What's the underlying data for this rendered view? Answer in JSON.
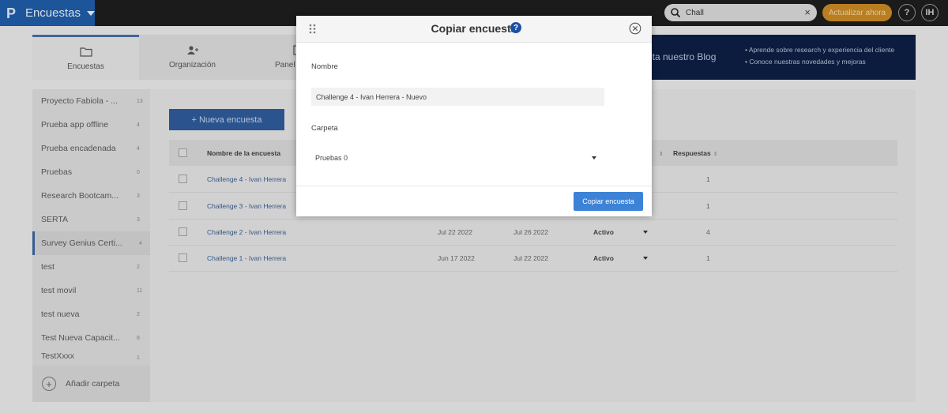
{
  "topbar": {
    "app_title": "Encuestas",
    "search_value": "Chall",
    "upgrade_label": "Actualizar ahora",
    "help_label": "?",
    "avatar_initials": "IH",
    "brand_color": "#1f5da6"
  },
  "tabs": [
    {
      "label": "Encuestas",
      "icon": "folder-icon"
    },
    {
      "label": "Organización",
      "icon": "users-icon"
    },
    {
      "label": "Panel",
      "icon": "panel-icon"
    }
  ],
  "blog_banner": {
    "title": "ita nuestro Blog",
    "bullets": [
      "Aprende sobre research y experiencia del cliente",
      "Conoce nuestras novedades y mejoras"
    ]
  },
  "sidebar": {
    "folders": [
      {
        "name": "Proyecto Fabiola - ...",
        "count": "13"
      },
      {
        "name": "Prueba app offline",
        "count": "4"
      },
      {
        "name": "Prueba encadenada",
        "count": "4"
      },
      {
        "name": "Pruebas",
        "count": "0"
      },
      {
        "name": "Research Bootcam...",
        "count": "3"
      },
      {
        "name": "SERTA",
        "count": "3"
      },
      {
        "name": "Survey Genius Certi...",
        "count": "4"
      },
      {
        "name": "test",
        "count": "2"
      },
      {
        "name": "test movil",
        "count": "11"
      },
      {
        "name": "test nueva",
        "count": "2"
      },
      {
        "name": "Test Nueva Capacit...",
        "count": "8"
      },
      {
        "name": "TestXxxx",
        "count": "1"
      }
    ],
    "active_index": 6,
    "add_folder_label": "Añadir carpeta"
  },
  "main": {
    "new_survey_label": "+ Nueva encuesta",
    "columns": {
      "name": "Nombre de la encuesta",
      "responses": "Respuestas"
    },
    "rows": [
      {
        "name": "Challenge 4 - Ivan Herrera",
        "created": "",
        "modified": "",
        "status": "",
        "responses": "1"
      },
      {
        "name": "Challenge 3 - Ivan Herrera",
        "created": "",
        "modified": "",
        "status": "",
        "responses": "1"
      },
      {
        "name": "Challenge 2 - Ivan Herrera",
        "created": "Jul 22 2022",
        "modified": "Jul 26 2022",
        "status": "Activo",
        "responses": "4"
      },
      {
        "name": "Challenge 1 - Ivan Herrera",
        "created": "Jun 17 2022",
        "modified": "Jul 22 2022",
        "status": "Activo",
        "responses": "1"
      }
    ]
  },
  "modal": {
    "title": "Copiar encuesta",
    "name_label": "Nombre",
    "name_value": "Challenge 4 - Ivan Herrera - Nuevo",
    "folder_label": "Carpeta",
    "folder_value": "Pruebas  0",
    "submit_label": "Copiar encuesta",
    "accent_color": "#3c83d8"
  }
}
